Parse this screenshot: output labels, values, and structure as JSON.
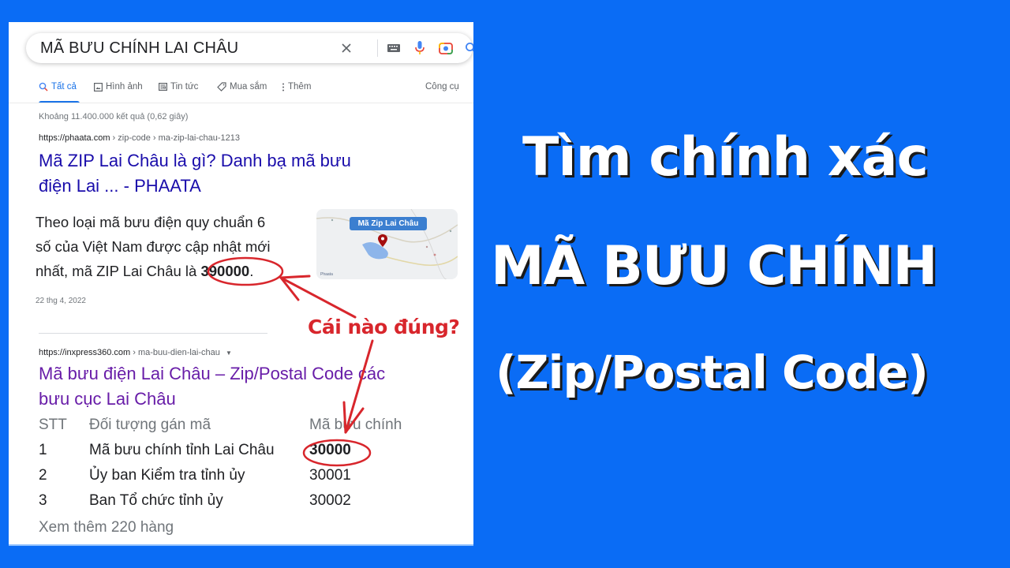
{
  "search": {
    "query": "MÃ BƯU CHÍNH LAI CHÂU",
    "icons": [
      "close-icon",
      "keyboard-icon",
      "microphone-icon",
      "camera-lens-icon",
      "search-icon"
    ]
  },
  "tabs": [
    {
      "label": "Tất cả",
      "icon": "search-icon",
      "active": true
    },
    {
      "label": "Hình ảnh",
      "icon": "image-icon",
      "active": false
    },
    {
      "label": "Tin tức",
      "icon": "news-icon",
      "active": false
    },
    {
      "label": "Mua sắm",
      "icon": "tag-icon",
      "active": false
    },
    {
      "label": "Thêm",
      "icon": "more-vert-icon",
      "active": false
    }
  ],
  "tools_label": "Công cụ",
  "result_stats": "Khoảng 11.400.000 kết quả (0,62 giây)",
  "results": [
    {
      "cite_domain": "https://phaata.com",
      "cite_path": " › zip-code › ma-zip-lai-chau-1213",
      "title_line1": "Mã ZIP Lai Châu là gì? Danh bạ mã bưu",
      "title_line2": "điện Lai ... - PHAATA",
      "snippet_line1": "Theo loại mã bưu điện quy chuẩn 6",
      "snippet_line2": "số của Việt Nam được cập nhật mới",
      "snippet_line3_pre": "nhất, mã ZIP Lai Châu là ",
      "snippet_code": "390000",
      "snippet_line3_post": ".",
      "date": "22 thg 4, 2022",
      "thumbnail_label": "Mã Zip Lai Châu",
      "thumbnail_brand": "Phaata"
    },
    {
      "cite_domain": "https://inxpress360.com",
      "cite_path": " › ma-buu-dien-lai-chau",
      "title_line1": "Mã bưu điện Lai Châu – Zip/Postal Code các",
      "title_line2": "bưu cục Lai Châu",
      "table": {
        "headers": [
          "STT",
          "Đối tượng gán mã",
          "Mã bưu chính"
        ],
        "rows": [
          [
            "1",
            "Mã bưu chính tỉnh Lai Châu",
            "30000"
          ],
          [
            "2",
            "Ủy ban Kiểm tra tỉnh ủy",
            "30001"
          ],
          [
            "3",
            "Ban Tổ chức tỉnh ủy",
            "30002"
          ]
        ]
      },
      "more_rows": "Xem thêm 220 hàng"
    }
  ],
  "annotation": {
    "question": "Cái nào đúng?",
    "color": "#d8262c"
  },
  "headline": {
    "line1": "Tìm chính xác",
    "line2": "MÃ BƯU CHÍNH",
    "line3": "(Zip/Postal Code)"
  },
  "colors": {
    "background": "#0a6cf5",
    "link": "#1a0dab",
    "visited_link": "#681da8",
    "accent": "#1a73e8"
  }
}
